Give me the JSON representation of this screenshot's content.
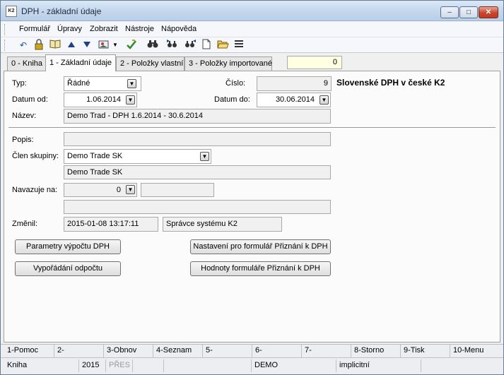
{
  "window": {
    "title": "DPH - základní údaje",
    "icon_label": "K2",
    "minimize": "‒",
    "maximize": "□",
    "close": "✕"
  },
  "menu": [
    "Formulář",
    "Úpravy",
    "Zobrazit",
    "Nástroje",
    "Nápověda"
  ],
  "toolbar": {
    "icons": [
      "undo-icon",
      "lock-icon",
      "book-icon",
      "arrow-up-icon",
      "arrow-down-icon",
      "image-icon",
      "dropdown-arrow-icon",
      "refresh-icon",
      "binoculars-icon",
      "find-next-icon",
      "find-prev-icon",
      "new-document-icon",
      "open-folder-icon",
      "list-icon"
    ]
  },
  "tabs": [
    "0 - Kniha",
    "1 - Základní údaje",
    "2 - Položky vlastní",
    "3 - Položky importované"
  ],
  "tab_counter": "0",
  "form": {
    "typ_label": "Typ:",
    "typ_value": "Řádné",
    "cislo_label": "Číslo:",
    "cislo_value": "9",
    "heading": "Slovenské DPH v české K2",
    "datum_od_label": "Datum od:",
    "datum_od_value": "1.06.2014",
    "datum_do_label": "Datum do:",
    "datum_do_value": "30.06.2014",
    "nazev_label": "Název:",
    "nazev_value": "Demo Trad - DPH 1.6.2014 - 30.6.2014",
    "popis_label": "Popis:",
    "popis_value": "",
    "clen_label": "Člen skupiny:",
    "clen_value": "Demo Trade SK",
    "clen_name": "Demo Trade SK",
    "navazuje_label": "Navazuje na:",
    "navazuje_value": "0",
    "zmenil_label": "Změnil:",
    "zmenil_date": "2015-01-08 13:17:11",
    "zmenil_user": "Správce systému K2"
  },
  "buttons": {
    "parametry": "Parametry výpočtu DPH",
    "nastaveni": "Nastavení pro formulář Přiznání k DPH",
    "vyporadani": "Vypořádání odpočtu",
    "hodnoty": "Hodnoty formuláře Přiznání k DPH"
  },
  "fkeys": [
    "1-Pomoc",
    "2-",
    "3-Obnov",
    "4-Seznam",
    "5-",
    "6-",
    "7-",
    "8-Storno",
    "9-Tisk",
    "10-Menu"
  ],
  "status": {
    "book": "Kniha",
    "year": "2015",
    "pres": "PŘES",
    "db": "DEMO",
    "mode": "implicitní"
  }
}
